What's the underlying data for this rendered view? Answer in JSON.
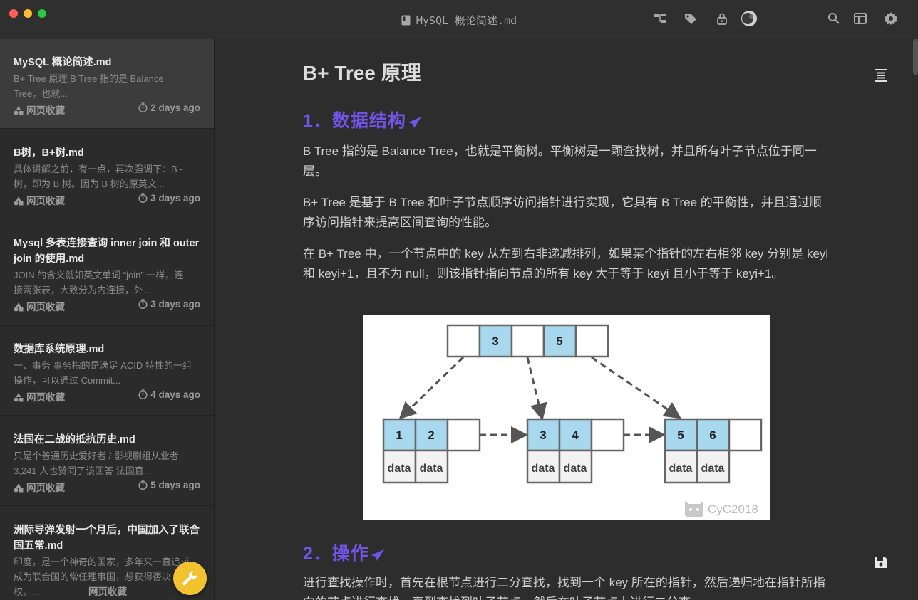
{
  "window": {
    "title": "MySQL 概论简述.md"
  },
  "notes": [
    {
      "title": "MySQL 概论简述.md",
      "excerpt": "B+ Tree 原理 B Tree 指的是 Balance Tree，也就...",
      "tag": "网页收藏",
      "time": "2 days ago"
    },
    {
      "title": "B树，B+树.md",
      "excerpt": "具体讲解之前，有一点，再次强调下：B -树，即为 B 树。因为 B 树的原英文...",
      "tag": "网页收藏",
      "time": "3 days ago"
    },
    {
      "title": "Mysql 多表连接查询 inner join 和 outer join 的使用.md",
      "excerpt": "JOIN 的含义就如英文单词 “join” 一样，连接两张表，大致分为内连接，外...",
      "tag": "网页收藏",
      "time": "3 days ago"
    },
    {
      "title": "数据库系统原理.md",
      "excerpt": "一、事务 事务指的是满足 ACID 特性的一组操作，可以通过 Commit...",
      "tag": "网页收藏",
      "time": "4 days ago"
    },
    {
      "title": "法国在二战的抵抗历史.md",
      "excerpt": "只是个普通历史爱好者 / 影视剧组从业者 3,241 人也赞同了该回答 法国直...",
      "tag": "网页收藏",
      "time": "5 days ago"
    },
    {
      "title": "洲际导弹发射一个月后，中国加入了联合国五常.md",
      "excerpt": "印度，是一个神奇的国家，多年来一直追求成为联合国的常任理事国，想获得否决权。...",
      "tag": "网页收藏",
      "time": ""
    }
  ],
  "doc": {
    "h1": "B+ Tree 原理",
    "sec1": "1．数据结构",
    "p1": "B Tree 指的是 Balance Tree，也就是平衡树。平衡树是一颗查找树，并且所有叶子节点位于同一层。",
    "p2": "B+ Tree 是基于 B Tree 和叶子节点顺序访问指针进行实现，它具有 B Tree 的平衡性，并且通过顺序访问指针来提高区间查询的性能。",
    "p3": "在 B+ Tree 中，一个节点中的 key 从左到右非递减排列，如果某个指针的左右相邻 key 分别是 keyi 和 keyi+1，且不为 null，则该指针指向节点的所有 key 大于等于 keyi 且小于等于 keyi+1。",
    "sec2": "2．操作",
    "p4": "进行查找操作时，首先在根节点进行二分查找，找到一个 key 所在的指针，然后递归地在指针所指向的节点进行查找。直到查找到叶子节点，然后在叶子节点上进行二分查"
  },
  "diagram": {
    "root_keys": [
      "3",
      "5"
    ],
    "leaves": [
      [
        "1",
        "2"
      ],
      [
        "3",
        "4"
      ],
      [
        "5",
        "6"
      ]
    ],
    "data_label": "data",
    "watermark": "CyC2018"
  },
  "colors": {
    "accent": "#6f55e8",
    "key_fill": "#a8d8ee",
    "fab": "#f2c230"
  }
}
